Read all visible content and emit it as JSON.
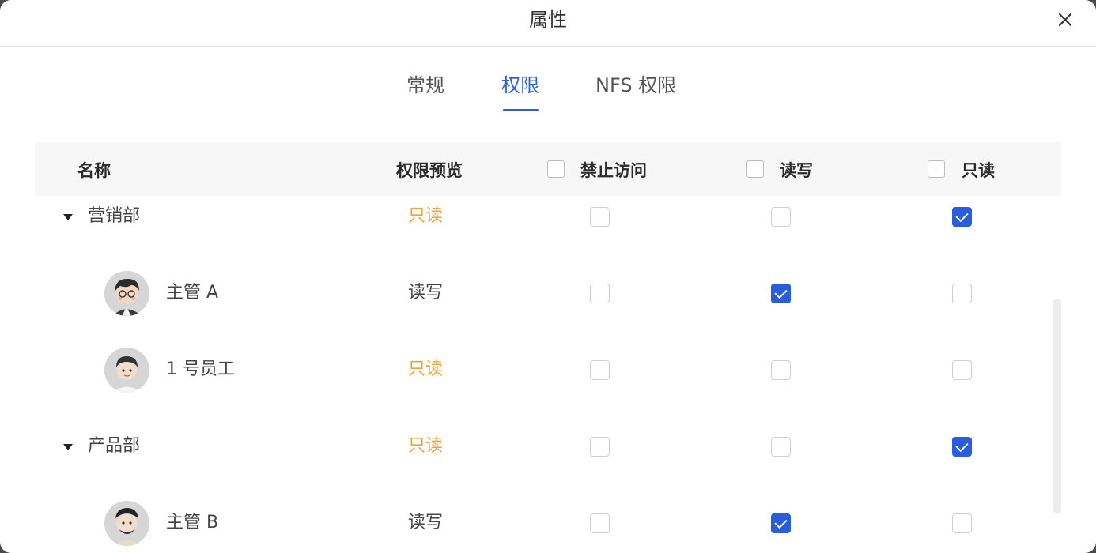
{
  "dialog": {
    "title": "属性"
  },
  "tabs": [
    {
      "label": "常规",
      "active": false
    },
    {
      "label": "权限",
      "active": true
    },
    {
      "label": "NFS 权限",
      "active": false
    }
  ],
  "table": {
    "headers": {
      "name": "名称",
      "preview": "权限预览",
      "deny": "禁止访问",
      "readwrite": "读写",
      "readonly": "只读"
    },
    "rows": [
      {
        "kind": "group",
        "name": "营销部",
        "preview": "只读",
        "deny": false,
        "readwrite": false,
        "readonly": true
      },
      {
        "kind": "member",
        "name": "主管 A",
        "preview": "读写",
        "deny": false,
        "readwrite": true,
        "readonly": false
      },
      {
        "kind": "member",
        "name": "1 号员工",
        "preview": "只读",
        "deny": false,
        "readwrite": false,
        "readonly": false
      },
      {
        "kind": "group",
        "name": "产品部",
        "preview": "只读",
        "deny": false,
        "readwrite": false,
        "readonly": true
      },
      {
        "kind": "member",
        "name": "主管 B",
        "preview": "读写",
        "deny": false,
        "readwrite": true,
        "readonly": false
      }
    ]
  },
  "colors": {
    "accent": "#2a5ddc",
    "readonly_text": "#f0a23a"
  }
}
